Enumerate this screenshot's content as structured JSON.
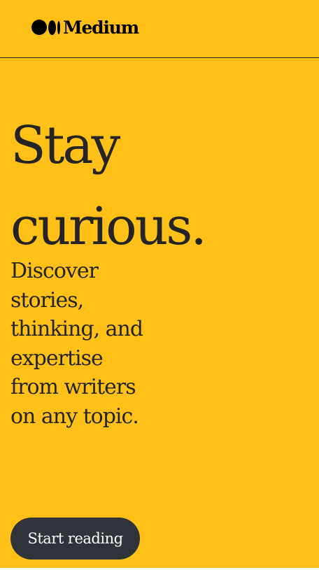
{
  "header": {
    "logo_text": "Medium",
    "logo_icon": "medium-logo-icon"
  },
  "hero": {
    "title_line1": "Stay",
    "title_line2": "curious.",
    "subtitle": "Discover stories, thinking, and expertise from writers on any topic.",
    "cta_label": "Start reading"
  },
  "colors": {
    "background": "#ffc017",
    "text": "#242424",
    "button": "#30343a",
    "button_text": "#ffffff"
  }
}
